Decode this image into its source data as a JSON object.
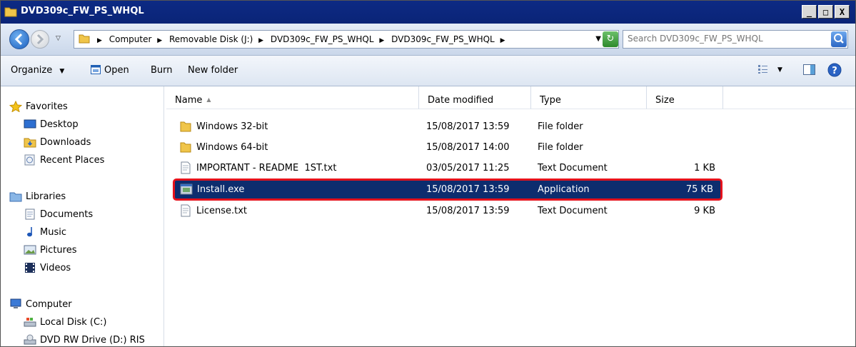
{
  "window": {
    "title": "DVD309c_FW_PS_WHQL",
    "controls": [
      "_",
      "□",
      "X"
    ]
  },
  "address": {
    "breadcrumbs": [
      "Computer",
      "Removable Disk (J:)",
      "DVD309c_FW_PS_WHQL",
      "DVD309c_FW_PS_WHQL"
    ],
    "search_placeholder": "Search DVD309c_FW_PS_WHQL"
  },
  "toolbar": {
    "organize": "Organize",
    "open": "Open",
    "burn": "Burn",
    "new_folder": "New folder"
  },
  "nav": {
    "favorites": "Favorites",
    "favorites_items": [
      "Desktop",
      "Downloads",
      "Recent Places"
    ],
    "libraries": "Libraries",
    "libraries_items": [
      "Documents",
      "Music",
      "Pictures",
      "Videos"
    ],
    "computer": "Computer",
    "computer_items": [
      "Local Disk (C:)",
      "DVD RW Drive (D:) RIS"
    ]
  },
  "columns": {
    "name": "Name",
    "date": "Date modified",
    "type": "Type",
    "size": "Size"
  },
  "files": [
    {
      "name": "Windows 32-bit",
      "date": "15/08/2017 13:59",
      "type": "File folder",
      "size": "",
      "icon": "folder-icon"
    },
    {
      "name": "Windows 64-bit",
      "date": "15/08/2017 14:00",
      "type": "File folder",
      "size": "",
      "icon": "folder-icon"
    },
    {
      "name": "IMPORTANT - README  1ST.txt",
      "date": "03/05/2017 11:25",
      "type": "Text Document",
      "size": "1 KB",
      "icon": "text-file-icon"
    },
    {
      "name": "Install.exe",
      "date": "15/08/2017 13:59",
      "type": "Application",
      "size": "75 KB",
      "icon": "exe-file-icon",
      "selected": true
    },
    {
      "name": "License.txt",
      "date": "15/08/2017 13:59",
      "type": "Text Document",
      "size": "9 KB",
      "icon": "text-file-icon"
    }
  ],
  "colors": {
    "titlebar": "#0a2477",
    "selection": "#0d2d6e",
    "highlight_border": "#e5121c"
  }
}
